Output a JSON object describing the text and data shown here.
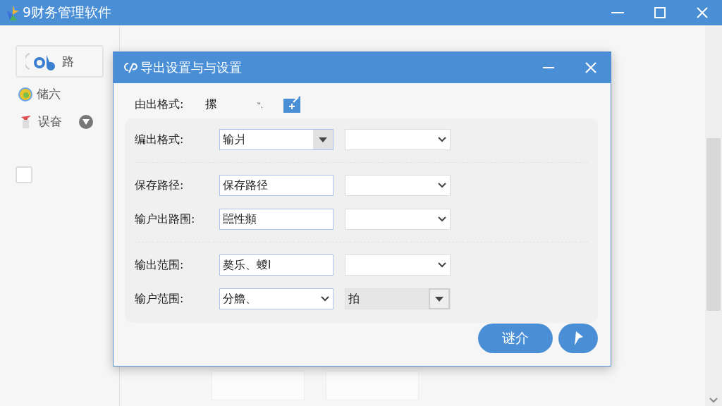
{
  "window": {
    "title": "9财务管理软件"
  },
  "sidebar": {
    "items": [
      {
        "label": "路",
        "kind": "logo",
        "selected": true
      },
      {
        "label": "储六",
        "kind": "coin",
        "selected": false
      },
      {
        "label": "误奋",
        "kind": "pin",
        "selected": false
      }
    ],
    "checkbox": {
      "checked": false
    }
  },
  "dialog": {
    "title": "导出设置与与设置",
    "format_line": {
      "label": "由出格式:",
      "value": "摞",
      "note": "ᵘ、"
    },
    "groups": [
      [
        {
          "label": "编出格式:",
          "field": {
            "kind": "split-select",
            "value": "输爿"
          },
          "option": {
            "disabled": false
          }
        }
      ],
      [
        {
          "label": "保存路径:",
          "field": {
            "kind": "input",
            "value": "保存路径"
          },
          "option": {
            "disabled": false
          }
        },
        {
          "label": "输户出路围:",
          "field": {
            "kind": "input",
            "value": "嚚性頫"
          },
          "option": {
            "disabled": false
          }
        }
      ],
      [
        {
          "label": "输出范围:",
          "field": {
            "kind": "input",
            "value": "獒乐、蝬l"
          },
          "option": {
            "disabled": false
          }
        },
        {
          "label": "输户范围:",
          "field": {
            "kind": "select",
            "value": "分艪、"
          },
          "option": {
            "disabled": true,
            "value": "拍"
          }
        }
      ]
    ],
    "buttons": [
      {
        "kind": "text",
        "label": "谜介"
      },
      {
        "kind": "icon"
      }
    ]
  }
}
